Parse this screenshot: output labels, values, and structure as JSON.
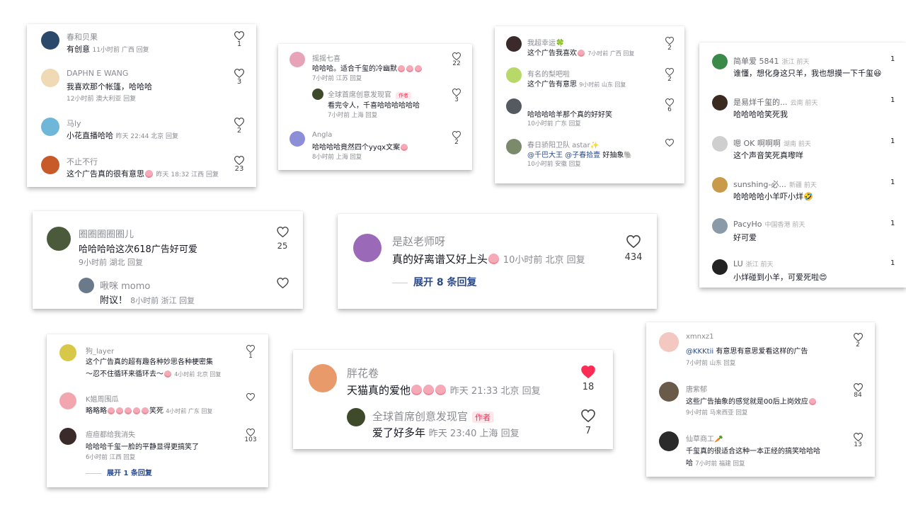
{
  "cards": [
    {
      "comments": [
        {
          "user": "春和贝果",
          "text": "有创意",
          "meta": "11小时前 广西 回复",
          "likes": "1",
          "avatar_color": "#2b4a6b"
        },
        {
          "user": "DAPHN E WANG",
          "text": "我喜欢那个帐篷，哈哈哈",
          "meta": "12小时前 澳大利亚 回复",
          "likes": "3",
          "avatar_color": "#f0d9b5"
        },
        {
          "user": "马ly",
          "text": "小花直播哈哈",
          "meta": "昨天 22:44 北京 回复",
          "likes": "2",
          "avatar_color": "#6fb7d9"
        },
        {
          "user": "不止不行",
          "text": "这个广告真的很有意思",
          "meta": "昨天 18:32 江西 回复",
          "likes": "23",
          "avatar_color": "#c85a2a"
        }
      ]
    },
    {
      "comments": [
        {
          "user": "摇摇七喜",
          "text": "哈哈哈。适合千玺的冷幽默",
          "meta": "7小时前 江苏 回复",
          "likes": "22",
          "avatar_color": "#e7a3b7"
        },
        {
          "user": "全球首席创意发现官",
          "author_tag": "作者",
          "text": "看完令人，千喜哈哈哈哈哈哈",
          "meta": "7小时前 上海 回复",
          "likes": "3",
          "avatar_color": "#3f4a2a"
        },
        {
          "user": "Angla",
          "text": "哈哈哈哈竟然四个yyqx文案",
          "meta": "8小时前 上海 回复",
          "likes": "2",
          "avatar_color": "#8c8fd8"
        }
      ]
    },
    {
      "comments": [
        {
          "user": "我超幸运🍀",
          "text": "这个广告我喜欢",
          "meta": "7小时前 广西 回复",
          "likes": "2",
          "avatar_color": "#3a2a2a"
        },
        {
          "user": "有名的梨吧啦",
          "text": "这个广告有意思",
          "meta": "9小时前 山东 回复",
          "likes": "2",
          "avatar_color": "#b8d86a"
        },
        {
          "user": "",
          "text": "哈哈哈哈羊那个真的好好笑",
          "meta": "10小时前 广东 回复",
          "likes": "6",
          "avatar_color": "#555a60"
        },
        {
          "user": "春日骄阳卫队 astar✨",
          "text": "好抽象🐘",
          "mentions": "@千巴大王 @子春拾壹",
          "meta": "10小时前 安徽 回复",
          "likes": "",
          "avatar_color": "#7a8a6a"
        }
      ]
    },
    {
      "comments": [
        {
          "user": "简单爱 5841",
          "tag": "浙江 前天",
          "text": "谁懂，想化身这只羊，我也想摸一下千玺😆",
          "likes": "1",
          "avatar_color": "#3a8a4a"
        },
        {
          "user": "是易烊千玺的...",
          "tag": "云南 前天",
          "text": "哈哈哈哈笑死我",
          "likes": "1",
          "avatar_color": "#3a2a20"
        },
        {
          "user": "嗯 OK 啊啊啊",
          "tag": "湖南 前天",
          "text": "这个声音笑死真嚟咩",
          "likes": "1",
          "avatar_color": "#e8e8e8"
        },
        {
          "user": "sunshing-必...",
          "tag": "新疆 前天",
          "text": "哈哈哈哈小羊吓小烊🤣",
          "likes": "1",
          "avatar_color": "#c89a4a"
        },
        {
          "user": "PacyHo",
          "tag": "中国香港 前天",
          "text": "好可爱",
          "likes": "1",
          "avatar_color": "#8a9aa8"
        },
        {
          "user": "LU",
          "tag": "浙江 前天",
          "text": "小烊碰到小羊，可爱死啦😍",
          "likes": "1",
          "avatar_color": "#222"
        }
      ]
    },
    {
      "comments": [
        {
          "user": "圈圈圈圈圈儿",
          "text": "哈哈哈哈这次618广告好可爱",
          "meta": "9小时前 湖北 回复",
          "likes": "25",
          "avatar_color": "#4a5a3a"
        },
        {
          "user": "啾咪 momo",
          "text": "附议！",
          "meta": "8小时前 浙江 回复",
          "likes": "",
          "avatar_color": "#6a7a8a"
        }
      ]
    },
    {
      "comments": [
        {
          "user": "是赵老师呀",
          "text": "真的好离谱又好上头",
          "meta": "10小时前 北京 回复",
          "likes": "434",
          "avatar_color": "#9a6ab8"
        }
      ],
      "expand": "展开 8 条回复"
    },
    {
      "comments": [
        {
          "user": "狗_layer",
          "text": "这个广告真的超有趣各种妙思各种梗密集",
          "text2": "～忍不住循环来循环去～",
          "meta": "4小时前 北京 回复",
          "likes": "1",
          "avatar_color": "#d8c84a"
        },
        {
          "user": "K姐周围瓜",
          "text": "略略略",
          "text_suffix": "笑死",
          "meta": "4小时前 广东 回复",
          "likes": "",
          "avatar_color": "#f2a6b0"
        },
        {
          "user": "痘痘都给我消失",
          "text": "哈哈哈千玺一脸的平静显得更搞笑了",
          "meta": "6小时前 江西 回复",
          "likes": "103",
          "avatar_color": "#3a2a2a"
        }
      ],
      "expand": "展开 1 条回复"
    },
    {
      "comments": [
        {
          "user": "胖花卷",
          "text": "天猫真的爱他",
          "meta": "昨天 21:33 北京 回复",
          "likes": "18",
          "liked": true,
          "avatar_color": "#e89a6a"
        },
        {
          "user": "全球首席创意发现官",
          "author_tag": "作者",
          "text": "爱了好多年",
          "meta": "昨天 23:40 上海 回复",
          "likes": "7",
          "avatar_color": "#3f4a2a"
        }
      ]
    },
    {
      "comments": [
        {
          "user": "xmnxz1",
          "text": "有意思有意思爱看这样的广告",
          "mentions": "@KKKtii",
          "meta": "7小时前 山东 回复",
          "likes": "2",
          "avatar_color": "#f2c8c0"
        },
        {
          "user": "唐紫郁",
          "text": "这些广告抽象的感觉就是00后上岗效应",
          "meta": "9小时前 马来西亚 回复",
          "likes": "84",
          "avatar_color": "#6a5a4a"
        },
        {
          "user": "仙草商工🥕",
          "text": "千玺真的很适合这种一本正经的搞笑哈哈哈",
          "text2": "哈",
          "meta": "7小时前 福建 回复",
          "likes": "13",
          "avatar_color": "#2a2a2a"
        }
      ]
    }
  ],
  "colors": {
    "liked": "#fe2c55",
    "meta": "#8a8b91",
    "link": "#2a4a8a"
  }
}
